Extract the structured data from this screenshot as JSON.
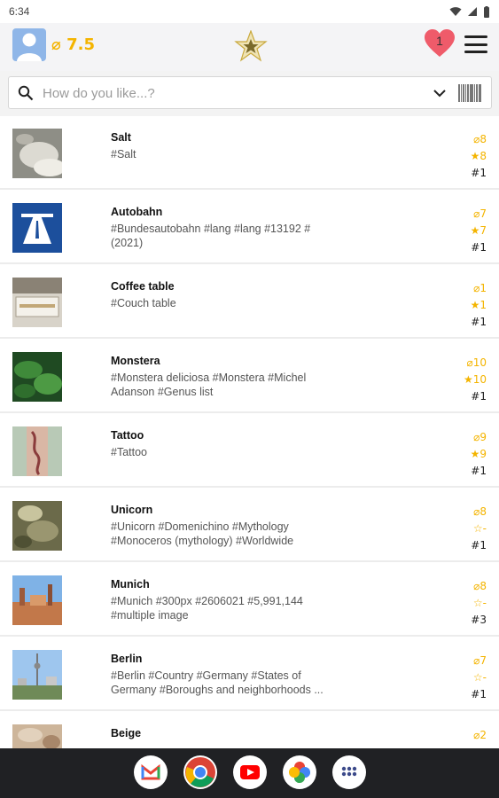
{
  "status_bar": {
    "time": "6:34"
  },
  "header": {
    "avg_score": "⌀ 7.5",
    "favorites_count": "1"
  },
  "search": {
    "placeholder": "How do you like...?"
  },
  "items": [
    {
      "title": "Salt",
      "tags": "#Salt",
      "avg": "⌀8",
      "stars": "★8",
      "rank": "#1"
    },
    {
      "title": "Autobahn",
      "tags": "#Bundesautobahn #lang #lang #13192 #(2021)",
      "avg": "⌀7",
      "stars": "★7",
      "rank": "#1"
    },
    {
      "title": "Coffee table",
      "tags": "#Couch table",
      "avg": "⌀1",
      "stars": "★1",
      "rank": "#1"
    },
    {
      "title": "Monstera",
      "tags": "#Monstera deliciosa #Monstera #Michel Adanson #Genus list",
      "avg": "⌀10",
      "stars": "★10",
      "rank": "#1"
    },
    {
      "title": "Tattoo",
      "tags": "#Tattoo",
      "avg": "⌀9",
      "stars": "★9",
      "rank": "#1"
    },
    {
      "title": "Unicorn",
      "tags": "#Unicorn #Domenichino #Mythology #Monoceros (mythology) #Worldwide",
      "avg": "⌀8",
      "stars": "☆-",
      "rank": "#1"
    },
    {
      "title": "Munich",
      "tags": "#Munich #300px #2606021 #5,991,144 #multiple image",
      "avg": "⌀8",
      "stars": "☆-",
      "rank": "#3"
    },
    {
      "title": "Berlin",
      "tags": "#Berlin #Country #Germany #States of Germany #Boroughs and neighborhoods ...",
      "avg": "⌀7",
      "stars": "☆-",
      "rank": "#1"
    },
    {
      "title": "Beige",
      "tags": "",
      "avg": "⌀2",
      "stars": "",
      "rank": ""
    }
  ],
  "colors": {
    "accent": "#f4b400",
    "heart": "#ef5b6a",
    "nav_bar": "#202124"
  },
  "icons": [
    "avatar-icon",
    "star-logo-icon",
    "heart-icon",
    "menu-icon",
    "search-icon",
    "chevron-down-icon",
    "barcode-icon",
    "gmail-icon",
    "chrome-icon",
    "youtube-icon",
    "photos-icon",
    "app-drawer-icon"
  ]
}
